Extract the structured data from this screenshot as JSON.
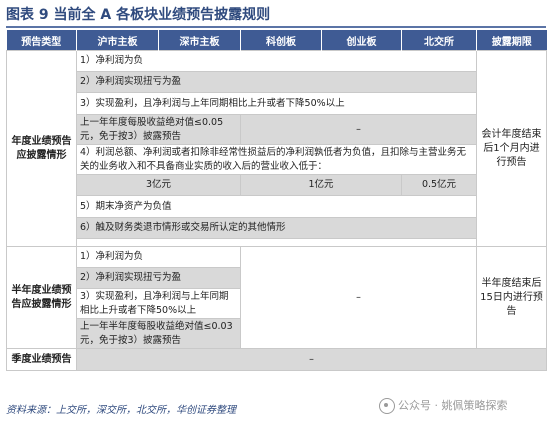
{
  "title": "图表 9   当前全 A 各板块业绩预告披露规则",
  "headers": [
    "预告类型",
    "沪市主板",
    "深市主板",
    "科创板",
    "创业板",
    "北交所",
    "披露期限"
  ],
  "annual": {
    "type": "年度业绩预告应披露情形",
    "conditions": {
      "c1": "1）净利润为负",
      "c2": "2）净利润实现扭亏为盈",
      "c3": "3）实现盈利，且净利润与上年同期相比上升或者下降50%以上",
      "c3b": "上一年年度每股收益绝对值≤0.05元，免于按3）披露预告",
      "c4": "4）利润总额、净利润或者扣除非经常性损益后的净利润孰低者为负值，且扣除与主营业务无关的业务收入和不具备商业实质的收入后的营业收入低于：",
      "c4_sh": "3亿元",
      "c4_ks": "1亿元",
      "c4_bj": "0.5亿元",
      "c5": "5）期末净资产为负值",
      "c6": "6）触及财务类退市情形或交易所认定的其他情形"
    },
    "dash": "–",
    "deadline": "会计年度结束后1个月内进行预告"
  },
  "half": {
    "type": "半年度业绩预告应披露情形",
    "conditions": {
      "c1": "1）净利润为负",
      "c2": "2）净利润实现扭亏为盈",
      "c3": "3）实现盈利，且净利润与上年同期相比上升或者下降50%以上",
      "c3b": "上一年半年度每股收益绝对值≤0.03元，免于按3）披露预告"
    },
    "dash": "–",
    "deadline": "半年度结束后15日内进行预告"
  },
  "quarterly": {
    "type": "季度业绩预告",
    "dash": "–"
  },
  "source": "资料来源：上交所，深交所，北交所，华创证券整理",
  "watermark": "公众号 · 姚佩策略探索"
}
